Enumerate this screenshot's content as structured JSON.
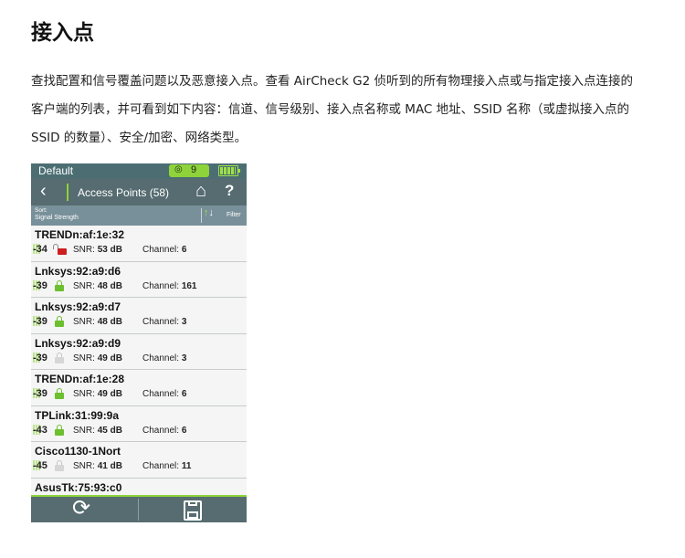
{
  "page": {
    "title": "接入点",
    "paragraph_lines": [
      "查找配置和信号覆盖问题以及恶意接入点。查看 AirCheck G2 侦听到的所有物理接入点或与指定接入点连接的",
      "客户端的列表，并可看到如下内容：信道、信号级别、接入点名称或 MAC 地址、SSID 名称（或虚拟接入点的",
      "SSID 的数量）、安全/加密、网络类型。"
    ]
  },
  "device": {
    "status": {
      "profile": "Default",
      "wifi_count": "9"
    },
    "nav": {
      "title": "Access Points (58)",
      "back_icon": "chevron-left-icon",
      "home_icon": "home-icon",
      "help_label": "?"
    },
    "sort": {
      "label": "Sort:",
      "value": "Signal Strength",
      "filter_label": "Filter"
    },
    "rows": [
      {
        "name": "TRENDn:af:1e:32",
        "signal": "-34",
        "lock": "red",
        "snr_label": "SNR:",
        "snr": "53 dB",
        "channel_label": "Channel:",
        "channel": "6"
      },
      {
        "name": "Lnksys:92:a9:d6",
        "signal": "-39",
        "lock": "green",
        "snr_label": "SNR:",
        "snr": "48 dB",
        "channel_label": "Channel:",
        "channel": "161"
      },
      {
        "name": "Lnksys:92:a9:d7",
        "signal": "-39",
        "lock": "green",
        "snr_label": "SNR:",
        "snr": "48 dB",
        "channel_label": "Channel:",
        "channel": "3"
      },
      {
        "name": "Lnksys:92:a9:d9",
        "signal": "-39",
        "lock": "grey",
        "snr_label": "SNR:",
        "snr": "49 dB",
        "channel_label": "Channel:",
        "channel": "3"
      },
      {
        "name": "TRENDn:af:1e:28",
        "signal": "-39",
        "lock": "green",
        "snr_label": "SNR:",
        "snr": "49 dB",
        "channel_label": "Channel:",
        "channel": "6"
      },
      {
        "name": "TPLink:31:99:9a",
        "signal": "-43",
        "lock": "green",
        "snr_label": "SNR:",
        "snr": "45 dB",
        "channel_label": "Channel:",
        "channel": "6"
      },
      {
        "name": "Cisco1130-1Nort",
        "signal": "-45",
        "lock": "grey",
        "snr_label": "SNR:",
        "snr": "41 dB",
        "channel_label": "Channel:",
        "channel": "11"
      },
      {
        "name": "AsusTk:75:93:c0"
      }
    ],
    "bottom": {
      "refresh_icon": "refresh-icon",
      "save_icon": "save-icon"
    },
    "colors": {
      "accent_green": "#8ed33a",
      "bar_teal": "#566c70",
      "lock_red": "#cc1f1f",
      "lock_green": "#6cbf2f"
    }
  }
}
